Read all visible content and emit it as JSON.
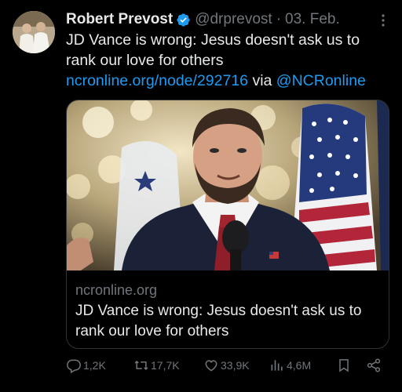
{
  "tweet": {
    "author_name": "Robert Prevost",
    "handle": "@drprevost",
    "separator": "·",
    "date": "03. Feb.",
    "text_main": "JD Vance is wrong: Jesus doesn't ask us to rank our love for others ",
    "text_link": "ncronline.org/node/292716",
    "text_via": " via ",
    "text_mention": "@NCRonline"
  },
  "card": {
    "domain": "ncronline.org",
    "title": "JD Vance is wrong: Jesus doesn't ask us to rank our love for others"
  },
  "actions": {
    "replies": "1,2K",
    "reposts": "17,7K",
    "likes": "33,9K",
    "views": "4,6M"
  },
  "icons": {
    "verified": "verified-badge-icon",
    "more": "more-options-icon",
    "reply": "reply-icon",
    "repost": "repost-icon",
    "like": "like-icon",
    "views": "views-icon",
    "bookmark": "bookmark-icon",
    "share": "share-icon"
  },
  "colors": {
    "background": "#000000",
    "text": "#e7e9ea",
    "secondary": "#71767b",
    "link": "#1d9bf0",
    "verified": "#1d9bf0"
  }
}
